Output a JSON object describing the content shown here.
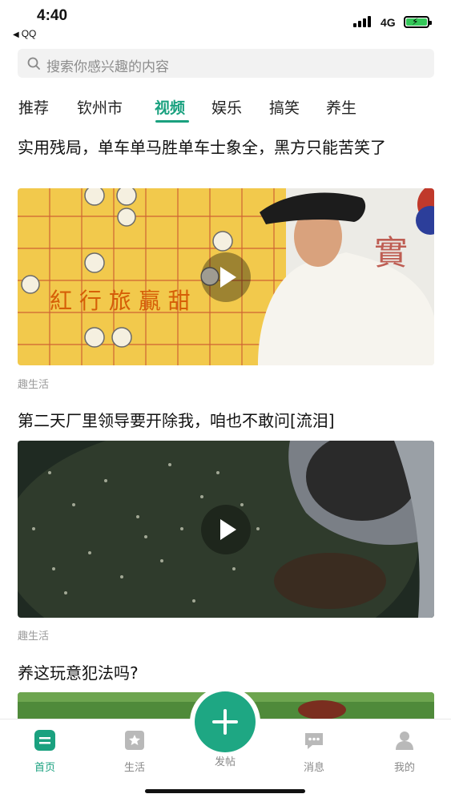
{
  "status_bar": {
    "time": "4:40",
    "back_app": "QQ",
    "network": "4G"
  },
  "search": {
    "placeholder": "搜索你感兴趣的内容"
  },
  "tabs": [
    "推荐",
    "钦州市",
    "视频",
    "娱乐",
    "搞笑",
    "养生"
  ],
  "active_tab": "视频",
  "feed": [
    {
      "title": "实用残局，单车单马胜单车士象全，黑方只能苦笑了",
      "source": "趣生活"
    },
    {
      "title": "第二天厂里领导要开除我，咱也不敢问[流泪]",
      "source": "趣生活"
    },
    {
      "title": "养这玩意犯法吗?"
    }
  ],
  "bottom_nav": {
    "home": "首页",
    "life": "生活",
    "post": "发帖",
    "messages": "消息",
    "mine": "我的"
  },
  "colors": {
    "accent": "#1aa17f",
    "fab": "#1ea783"
  }
}
